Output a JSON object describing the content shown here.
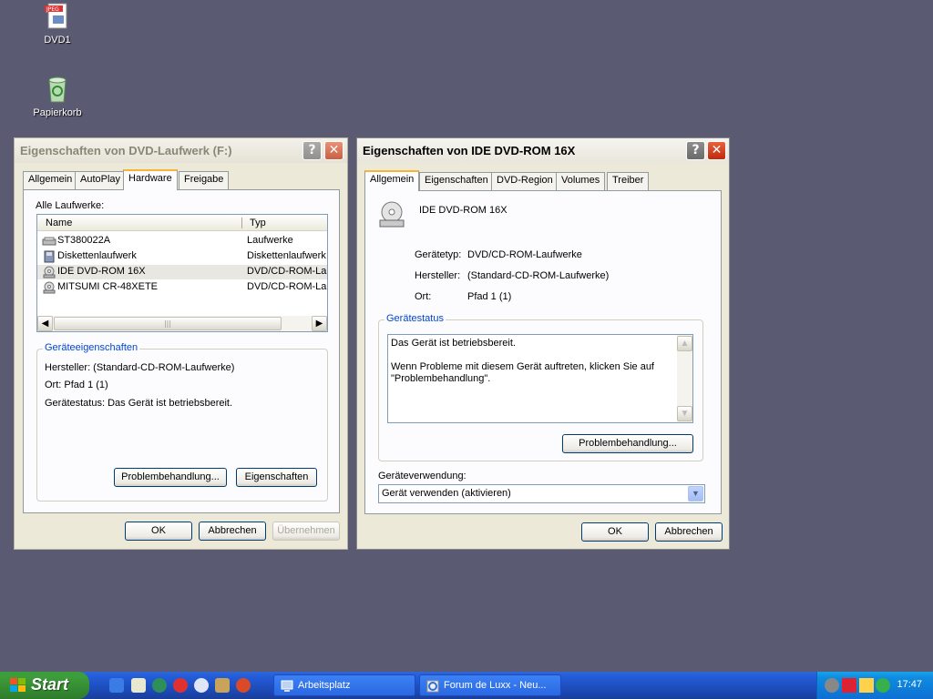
{
  "desktop": {
    "icons": [
      {
        "label": "DVD1",
        "icon": "jpeg-file-icon"
      },
      {
        "label": "Papierkorb",
        "icon": "recycle-bin-icon"
      }
    ]
  },
  "win1": {
    "title": "Eigenschaften von DVD-Laufwerk (F:)",
    "tabs": [
      "Allgemein",
      "AutoPlay",
      "Hardware",
      "Freigabe"
    ],
    "selected_tab": "Hardware",
    "all_drives_label": "Alle Laufwerke:",
    "columns": [
      "Name",
      "Typ"
    ],
    "rows": [
      {
        "name": "ST380022A",
        "type": "Laufwerke",
        "icon": "hard-disk-icon"
      },
      {
        "name": "Diskettenlaufwerk",
        "type": "Diskettenlaufwerk",
        "icon": "floppy-drive-icon"
      },
      {
        "name": "IDE DVD-ROM 16X",
        "type": "DVD/CD-ROM-Lau",
        "icon": "cd-drive-icon",
        "selected": true
      },
      {
        "name": "MITSUMI CR-48XETE",
        "type": "DVD/CD-ROM-Lau",
        "icon": "cd-drive-icon"
      }
    ],
    "group_title": "Geräteeigenschaften",
    "manufacturer": "Hersteller: (Standard-CD-ROM-Laufwerke)",
    "location": "Ort: Pfad 1 (1)",
    "status": "Gerätestatus: Das Gerät ist betriebsbereit.",
    "btn_troubleshoot": "Problembehandlung...",
    "btn_properties": "Eigenschaften",
    "btn_ok": "OK",
    "btn_cancel": "Abbrechen",
    "btn_apply": "Übernehmen"
  },
  "win2": {
    "title": "Eigenschaften von IDE DVD-ROM 16X",
    "tabs": [
      "Allgemein",
      "Eigenschaften",
      "DVD-Region",
      "Volumes",
      "Treiber"
    ],
    "selected_tab": "Allgemein",
    "device_name": "IDE DVD-ROM 16X",
    "device_type_label": "Gerätetyp:",
    "device_type_value": "DVD/CD-ROM-Laufwerke",
    "manufacturer_label": "Hersteller:",
    "manufacturer_value": "(Standard-CD-ROM-Laufwerke)",
    "location_label": "Ort:",
    "location_value": "Pfad 1 (1)",
    "group_title": "Gerätestatus",
    "status_line1": "Das Gerät ist betriebsbereit.",
    "status_line2": "Wenn Probleme mit diesem Gerät auftreten, klicken Sie auf",
    "status_line3": "\"Problembehandlung\".",
    "btn_troubleshoot": "Problembehandlung...",
    "usage_label": "Geräteverwendung:",
    "usage_value": "Gerät verwenden (aktivieren)",
    "btn_ok": "OK",
    "btn_cancel": "Abbrechen"
  },
  "taskbar": {
    "start_label": "Start",
    "tasks": [
      {
        "label": "Arbeitsplatz",
        "icon": "my-computer-icon"
      },
      {
        "label": "Forum de Luxx - Neu...",
        "icon": "internet-explorer-icon"
      }
    ],
    "clock": "17:47"
  }
}
